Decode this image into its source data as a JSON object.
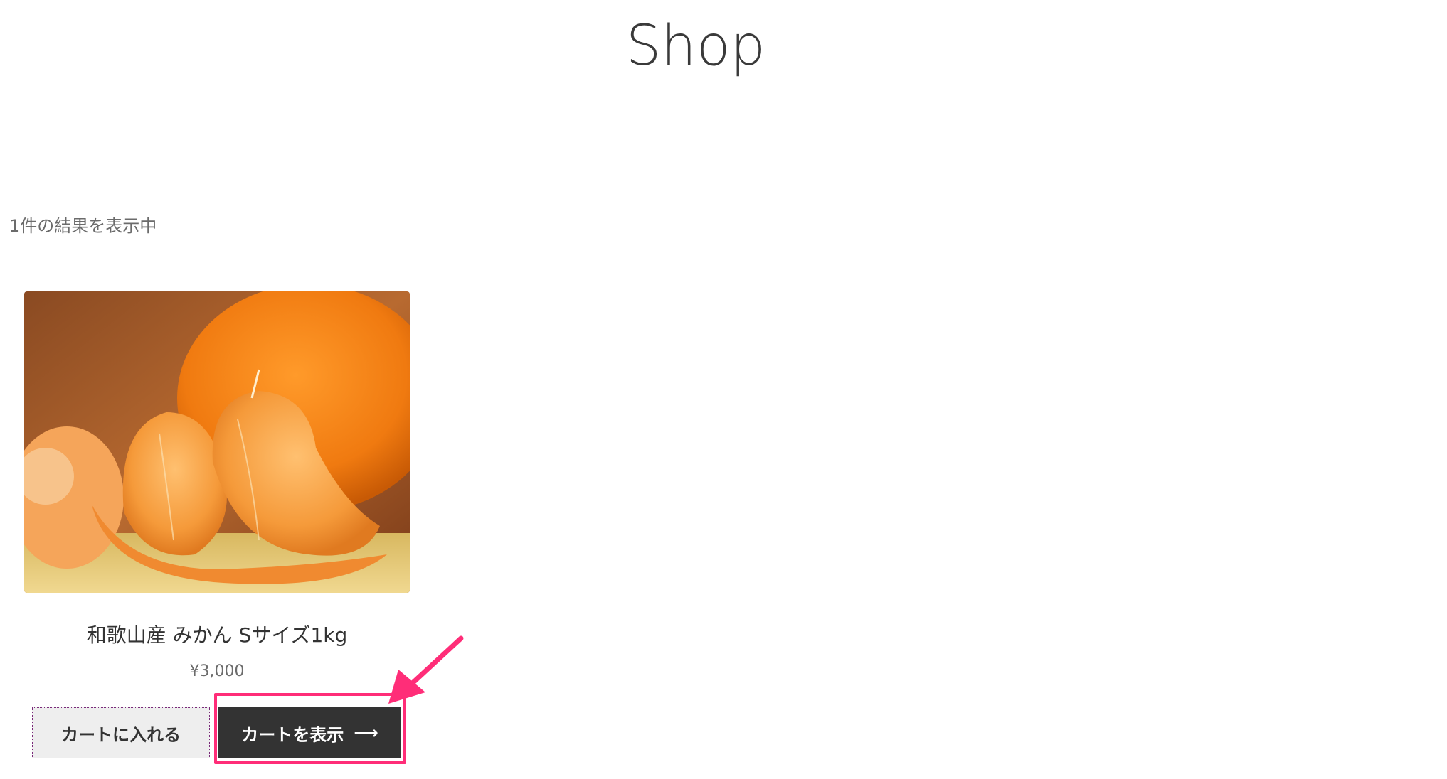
{
  "page": {
    "title": "Shop"
  },
  "results": {
    "count_text": "1件の結果を表示中"
  },
  "product": {
    "name": "和歌山産 みかん Sサイズ1kg",
    "price": "¥3,000",
    "image_icon": "mandarin-orange-photo"
  },
  "buttons": {
    "add_to_cart_label": "カートに入れる",
    "view_cart_label": "カートを表示",
    "view_cart_arrow": "⟶"
  },
  "annotation": {
    "highlight_color": "#ff2d78"
  }
}
